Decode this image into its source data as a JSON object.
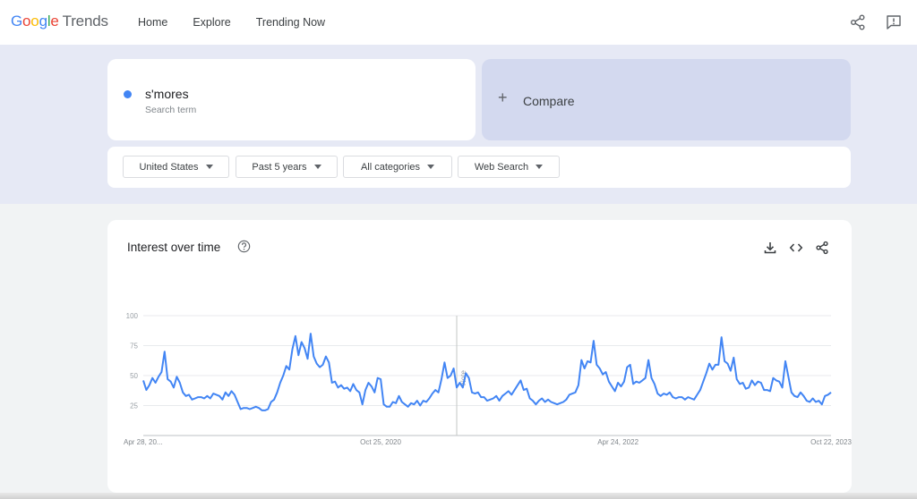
{
  "header": {
    "logo_google": "Google",
    "logo_product": "Trends",
    "nav": [
      {
        "label": "Home"
      },
      {
        "label": "Explore"
      },
      {
        "label": "Trending Now"
      }
    ],
    "icons": [
      "share-icon",
      "feedback-icon"
    ]
  },
  "search": {
    "term": "s'mores",
    "term_type": "Search term",
    "compare_label": "Compare",
    "term_color": "#4285f4"
  },
  "filters": {
    "region": "United States",
    "period": "Past 5 years",
    "category": "All categories",
    "search_type": "Web Search"
  },
  "panel": {
    "title": "Interest over time",
    "icons": [
      "help-icon",
      "download-icon",
      "embed-icon",
      "share-icon"
    ]
  },
  "chart_data": {
    "type": "line",
    "title": "Interest over time",
    "ylim": [
      0,
      100
    ],
    "y_ticks": [
      100,
      75,
      50,
      25
    ],
    "x_tick_labels": [
      "Apr 28, 20...",
      "Oct 25, 2020",
      "Apr 24, 2022",
      "Oct 22, 2023"
    ],
    "annotation": "Note",
    "annotation_index": 103,
    "grid": true,
    "color": "#4285f4",
    "series": [
      {
        "values": [
          46,
          38,
          42,
          48,
          44,
          49,
          53,
          70,
          47,
          45,
          40,
          49,
          44,
          36,
          33,
          34,
          30,
          31,
          32,
          32,
          31,
          33,
          31,
          35,
          34,
          33,
          30,
          36,
          33,
          37,
          34,
          28,
          22,
          23,
          23,
          22,
          23,
          24,
          23,
          21,
          21,
          22,
          28,
          30,
          36,
          44,
          50,
          58,
          55,
          72,
          83,
          67,
          78,
          73,
          64,
          85,
          66,
          60,
          57,
          59,
          66,
          61,
          44,
          45,
          40,
          42,
          39,
          40,
          37,
          43,
          38,
          36,
          26,
          38,
          44,
          41,
          36,
          48,
          47,
          26,
          24,
          24,
          28,
          27,
          33,
          28,
          26,
          24,
          27,
          26,
          29,
          25,
          29,
          28,
          31,
          35,
          38,
          36,
          47,
          61,
          48,
          50,
          56,
          40,
          44,
          40,
          52,
          48,
          36,
          35,
          36,
          32,
          32,
          29,
          30,
          31,
          33,
          29,
          33,
          35,
          37,
          34,
          38,
          42,
          46,
          38,
          39,
          31,
          29,
          26,
          29,
          31,
          28,
          30,
          28,
          27,
          26,
          27,
          28,
          30,
          34,
          35,
          36,
          42,
          63,
          56,
          62,
          61,
          79,
          59,
          56,
          51,
          53,
          45,
          41,
          37,
          44,
          41,
          45,
          57,
          59,
          43,
          45,
          44,
          46,
          48,
          63,
          48,
          43,
          35,
          33,
          35,
          34,
          36,
          32,
          31,
          32,
          32,
          30,
          32,
          31,
          30,
          34,
          38,
          45,
          52,
          60,
          55,
          59,
          59,
          82,
          62,
          60,
          54,
          65,
          47,
          43,
          44,
          39,
          40,
          46,
          42,
          45,
          44,
          38,
          38,
          37,
          48,
          46,
          45,
          40,
          62,
          49,
          36,
          33,
          32,
          36,
          33,
          29,
          28,
          31,
          28,
          29,
          26,
          33,
          34,
          36
        ]
      }
    ]
  }
}
